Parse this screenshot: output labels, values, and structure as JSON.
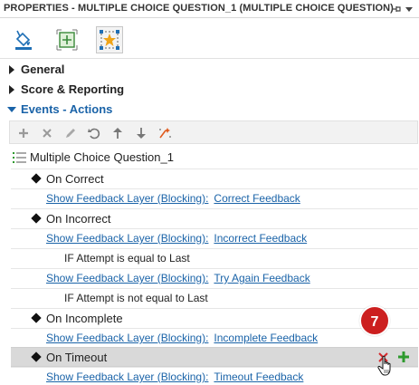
{
  "panel": {
    "title": "PROPERTIES - MULTIPLE CHOICE QUESTION_1 (MULTIPLE CHOICE QUESTION)",
    "pin_icon": "pin-icon",
    "menu_icon": "dropdown-menu-icon"
  },
  "tabs": [
    {
      "name": "fill-style-tab",
      "icon": "paint-bucket-icon",
      "active": false
    },
    {
      "name": "size-position-tab",
      "icon": "resize-icon",
      "active": false
    },
    {
      "name": "interaction-tab",
      "icon": "star-selection-icon",
      "active": true
    }
  ],
  "sections": {
    "general": "General",
    "score_reporting": "Score & Reporting",
    "events_actions": "Events - Actions"
  },
  "toolbar_icons": [
    "add-icon",
    "delete-icon",
    "edit-icon",
    "undo-icon",
    "move-up-icon",
    "move-down-icon",
    "magic-wand-icon"
  ],
  "tree": {
    "root": "Multiple Choice Question_1",
    "on_correct": "On Correct",
    "on_correct_action": "Show Feedback Layer (Blocking):",
    "on_correct_target": "Correct Feedback",
    "on_incorrect": "On Incorrect",
    "on_incorrect_action": "Show Feedback Layer (Blocking):",
    "on_incorrect_target": "Incorrect Feedback",
    "cond_equal": "IF Attempt is equal to Last",
    "try_again_action": "Show Feedback Layer (Blocking):",
    "try_again_target": "Try Again Feedback",
    "cond_not_equal": "IF Attempt is not equal to Last",
    "on_incomplete": "On Incomplete",
    "on_incomplete_action": "Show Feedback Layer (Blocking):",
    "on_incomplete_target": "Incomplete Feedback",
    "on_timeout": "On Timeout",
    "on_timeout_action": "Show Feedback Layer (Blocking):",
    "on_timeout_target": "Timeout Feedback"
  },
  "badge": "7",
  "colors": {
    "link": "#1a63a8",
    "badge": "#cc1f1f",
    "delete": "#d6262a",
    "add": "#2e9a2e",
    "selected_row": "#d9d9d9"
  }
}
